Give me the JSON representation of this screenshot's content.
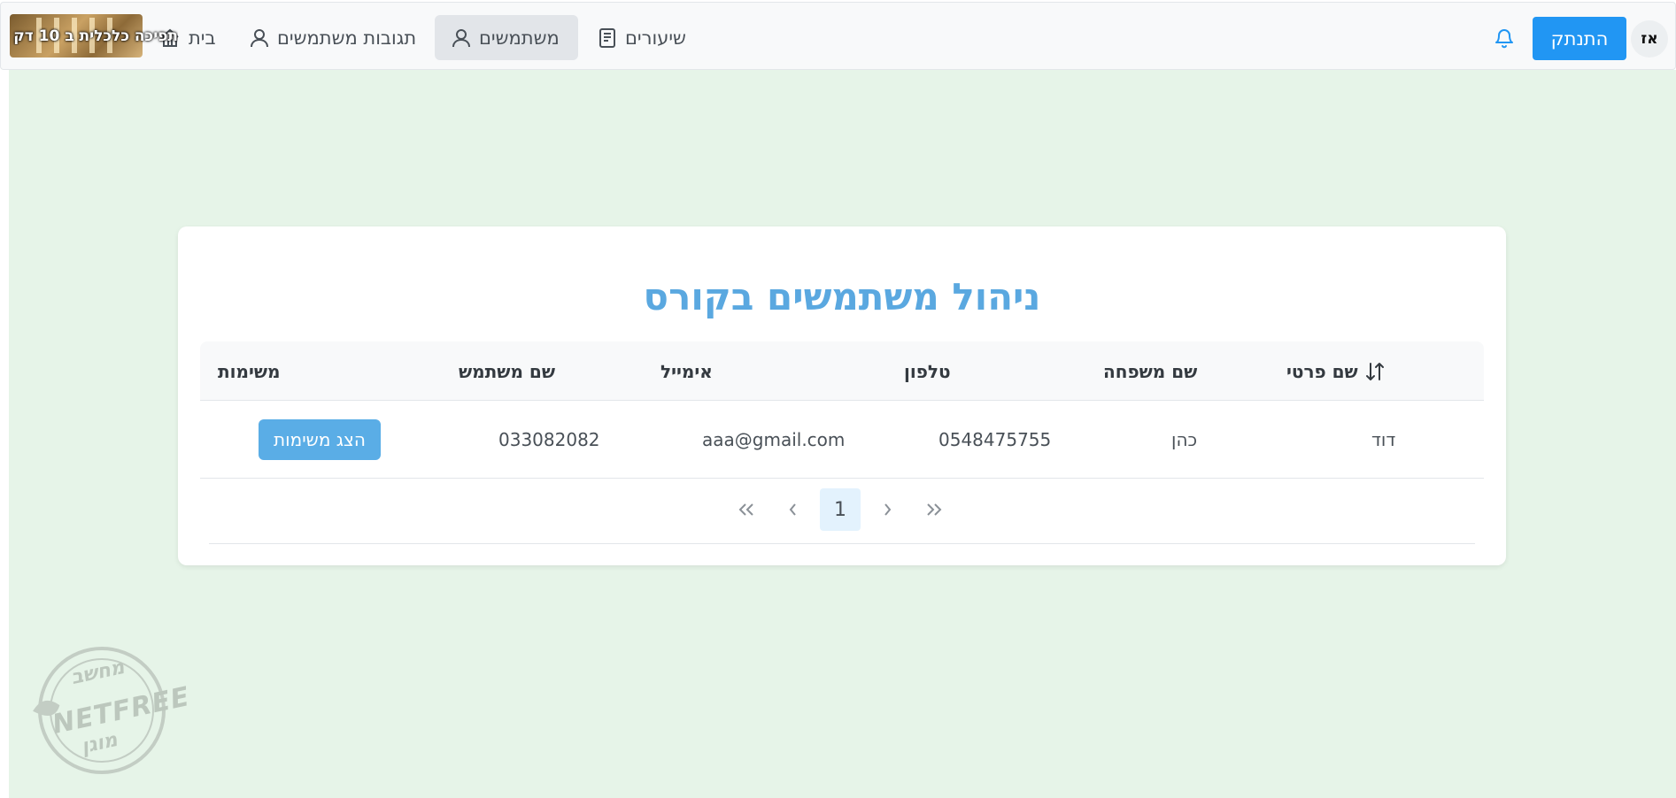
{
  "header": {
    "avatar_initials": "אז",
    "logout_label": "התנתק",
    "bell_icon": "bell-icon",
    "nav": [
      {
        "label": "שיעורים",
        "icon": "book-icon"
      },
      {
        "label": "משתמשים",
        "icon": "user-icon",
        "active": true
      },
      {
        "label": "תגובות משתמשים",
        "icon": "user-icon"
      },
      {
        "label": "בית",
        "icon": "home-icon"
      }
    ],
    "promo_text": "תפיכה כלכלית ב 10 דק"
  },
  "main": {
    "title": "ניהול משתמשים בקורס",
    "table": {
      "columns": [
        "שם פרטי",
        "שם משפחה",
        "טלפון",
        "אימייל",
        "שם משתמש",
        "משימות"
      ],
      "sort_icon": "sort-arrows-icon",
      "rows": [
        {
          "first_name": "דוד",
          "last_name": "כהן",
          "phone": "0548475755",
          "email": "aaa@gmail.com",
          "username": "033082082",
          "tasks_button": "הצג משימות"
        }
      ]
    },
    "pagination": {
      "current_page": "1",
      "first_icon": "double-chevron-right-icon",
      "prev_icon": "chevron-right-icon",
      "next_icon": "chevron-left-icon",
      "last_icon": "double-chevron-left-icon"
    }
  },
  "watermark": {
    "top": "מחשב",
    "middle": "NETFREE",
    "bottom": "מוגן"
  },
  "colors": {
    "accent": "#2196f3",
    "title": "#5aa8e0",
    "tasks_button": "#5aade6",
    "page_background": "#e6f4e8"
  }
}
